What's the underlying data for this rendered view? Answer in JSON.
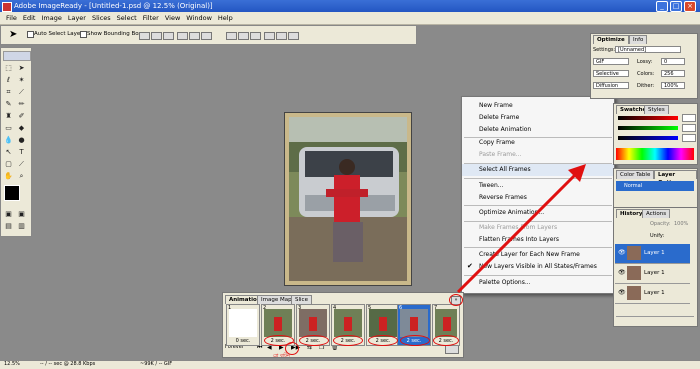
{
  "window": {
    "title": "Adobe ImageReady - [Untitled-1.psd @ 12.5% (Original)]",
    "minimize": "_",
    "maximize": "□",
    "close": "×"
  },
  "menubar": {
    "items": [
      "File",
      "Edit",
      "Image",
      "Layer",
      "Slices",
      "Select",
      "Filter",
      "View",
      "Window",
      "Help"
    ]
  },
  "options_bar": {
    "auto_select_layer": "Auto Select Layer",
    "show_bounding_box": "Show Bounding Box"
  },
  "optimize_panel": {
    "tabs": [
      "Optimize",
      "Info"
    ],
    "settings_label": "Settings:",
    "settings_value": "[Unnamed]",
    "format": "GIF",
    "lossy_label": "Lossy:",
    "lossy_value": "0",
    "palette": "Selective",
    "colors_label": "Colors:",
    "colors_value": "256",
    "dither_method": "Diffusion",
    "dither_label": "Dither:",
    "dither_value": "100%"
  },
  "swatches_panel": {
    "tabs": [
      "Swatches",
      "Styles"
    ]
  },
  "color_table_panel": {
    "tabs": [
      "Color Table",
      "Layer Options"
    ],
    "normal": "Normal"
  },
  "history_panel": {
    "tabs": [
      "History",
      "Actions"
    ],
    "opacity_label": "Opacity:",
    "opacity_value": "100%",
    "unify_label": "Unify:",
    "layers": [
      "Layer 1",
      "Layer 1",
      "Layer 1"
    ]
  },
  "context_menu": {
    "items": [
      {
        "label": "New Frame",
        "disabled": false
      },
      {
        "label": "Delete Frame",
        "disabled": false
      },
      {
        "label": "Delete Animation",
        "disabled": false
      },
      {
        "label": "Copy Frame",
        "disabled": false
      },
      {
        "label": "Paste Frame...",
        "disabled": true
      },
      {
        "label": "Select All Frames",
        "disabled": false,
        "highlight": true
      },
      {
        "label": "Tween...",
        "disabled": false
      },
      {
        "label": "Reverse Frames",
        "disabled": false
      },
      {
        "label": "Optimize Animation...",
        "disabled": false
      },
      {
        "label": "Make Frames From Layers",
        "disabled": true
      },
      {
        "label": "Flatten Frames Into Layers",
        "disabled": false
      },
      {
        "label": "Create Layer for Each New Frame",
        "disabled": false
      },
      {
        "label": "New Layers Visible in All States/Frames",
        "disabled": false,
        "checked": true
      },
      {
        "label": "Palette Options...",
        "disabled": false
      }
    ]
  },
  "animation_panel": {
    "tabs": [
      "Animation",
      "Image Map",
      "Slice"
    ],
    "frames": [
      {
        "num": "1",
        "delay": "0 sec."
      },
      {
        "num": "2",
        "delay": "2 sec."
      },
      {
        "num": "3",
        "delay": "2 sec."
      },
      {
        "num": "4",
        "delay": "2 sec."
      },
      {
        "num": "5",
        "delay": "2 sec."
      },
      {
        "num": "6",
        "delay": "2 sec."
      },
      {
        "num": "7",
        "delay": "2 sec."
      }
    ],
    "loop": "Forever",
    "note": "প্লে বাটন"
  },
  "statusbar": {
    "zoom": "12.5%",
    "size": "-- / -- sec @ 28.8 Kbps",
    "info": "~99K / -- GIF"
  },
  "colors": {
    "accent": "#2456c2",
    "arrow": "#e01010"
  }
}
